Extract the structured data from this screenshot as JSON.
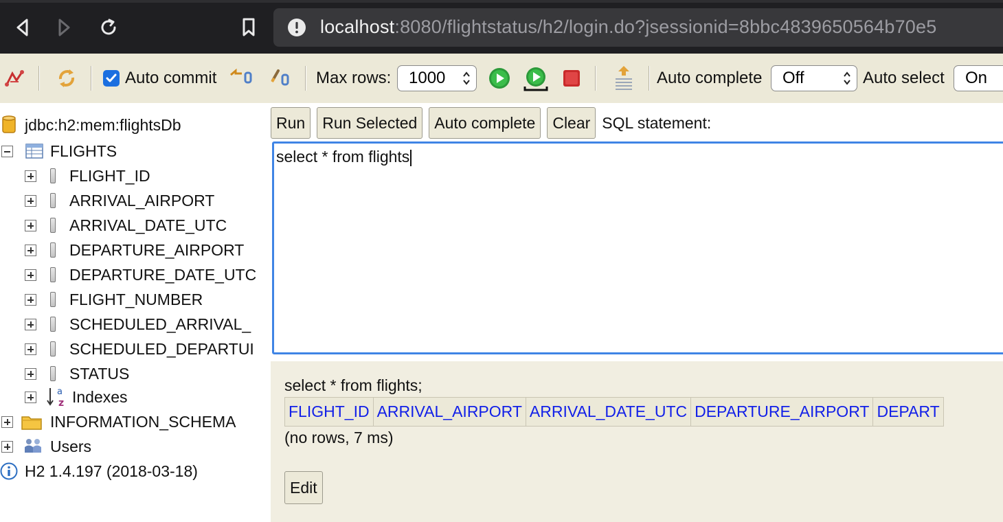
{
  "browser": {
    "url_host": "localhost",
    "url_rest": ":8080/flightstatus/h2/login.do?jsessionid=8bbc4839650564b70e5",
    "icons": [
      "back-icon",
      "forward-icon",
      "reload-icon",
      "bookmark-icon",
      "not-secure-icon"
    ]
  },
  "toolbar": {
    "auto_commit_label": "Auto commit",
    "auto_commit_checked": true,
    "max_rows_label": "Max rows:",
    "max_rows_value": "1000",
    "auto_complete_label": "Auto complete",
    "auto_complete_value": "Off",
    "auto_select_label": "Auto select",
    "auto_select_value": "On",
    "icons": [
      "disconnect-icon",
      "refresh-icon",
      "rollback-icon",
      "commit-icon",
      "run-icon",
      "run-selected-icon",
      "stop-icon",
      "history-icon"
    ]
  },
  "tree": {
    "connection": "jdbc:h2:mem:flightsDb",
    "table": "FLIGHTS",
    "columns": [
      "FLIGHT_ID",
      "ARRIVAL_AIRPORT",
      "ARRIVAL_DATE_UTC",
      "DEPARTURE_AIRPORT",
      "DEPARTURE_DATE_UTC",
      "FLIGHT_NUMBER",
      "SCHEDULED_ARRIVAL_",
      "SCHEDULED_DEPARTUI",
      "STATUS"
    ],
    "indexes": "Indexes",
    "information_schema": "INFORMATION_SCHEMA",
    "users": "Users",
    "version": "H2 1.4.197 (2018-03-18)"
  },
  "main": {
    "buttons": {
      "run": "Run",
      "run_selected": "Run Selected",
      "auto_complete": "Auto complete",
      "clear": "Clear"
    },
    "sql_label": "SQL statement:",
    "sql_text": "select * from flights",
    "result": {
      "statement": "select * from flights;",
      "headers": [
        "FLIGHT_ID",
        "ARRIVAL_AIRPORT",
        "ARRIVAL_DATE_UTC",
        "DEPARTURE_AIRPORT",
        "DEPART"
      ],
      "info": "(no rows, 7 ms)",
      "edit_button": "Edit"
    }
  },
  "colors": {
    "toolbar_bg": "#ece9d8",
    "result_bg": "#f1eee1",
    "header_link": "#1220e8",
    "editor_focus": "#3f84e5"
  }
}
